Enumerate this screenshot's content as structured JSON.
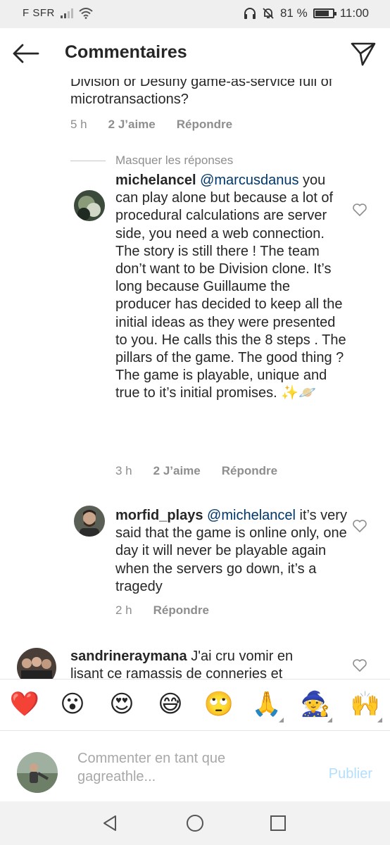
{
  "status_bar": {
    "carrier": "F SFR",
    "battery_percent_text": "81 %",
    "battery_level": 0.81,
    "time": "11:00",
    "icons": [
      "signal-icon",
      "wifi-icon",
      "headphones-icon",
      "bell-muted-icon",
      "battery-icon"
    ]
  },
  "header": {
    "title": "Commentaires",
    "icons": [
      "back-arrow-icon",
      "send-icon"
    ]
  },
  "top_comment": {
    "text_tail": "Division or Destiny game-as-service full of microtransactions?",
    "time": "5 h",
    "likes": "2 J’aime",
    "reply": "Répondre"
  },
  "hide_replies": "Masquer les réponses",
  "replies": [
    {
      "username": "michelancel",
      "mention": "@marcusdanus",
      "text": "you can play alone but because a lot of procedural calculations are server side, you need a web connection. The story is still there ! The team don’t want to be Division clone. It’s long because Guillaume the producer has decided to keep all the initial ideas as they were presented to you. He calls this the 8 steps . The pillars of the game. The good thing ? The game is playable, unique and true to it’s initial promises. ✨🪐",
      "time": "3 h",
      "likes": "2 J’aime",
      "reply": "Répondre"
    },
    {
      "username": "morfid_plays",
      "mention": "@michelancel",
      "text": "it’s very said that the game is online only, one day it will never be playable again when the servers go down, it’s a tragedy",
      "time": "2 h",
      "reply": "Répondre"
    }
  ],
  "next_comment": {
    "username": "sandrineraymana",
    "text": "J'ai cru vomir en lisant ce ramassis de conneries et"
  },
  "emoji_bar": [
    "❤️",
    "😮",
    "😍",
    "😅",
    "🙄",
    "🙏",
    "🧙",
    "🙌"
  ],
  "composer": {
    "placeholder": "Commenter en tant que gagreathle...",
    "publish": "Publier"
  },
  "nav_bar": [
    "back-triangle-icon",
    "home-circle-icon",
    "recents-square-icon"
  ],
  "colors": {
    "accent_link": "#00376b",
    "publish_disabled": "#b2dffc",
    "meta_gray": "#8e8e8e",
    "heart_like": "#ed4956"
  }
}
